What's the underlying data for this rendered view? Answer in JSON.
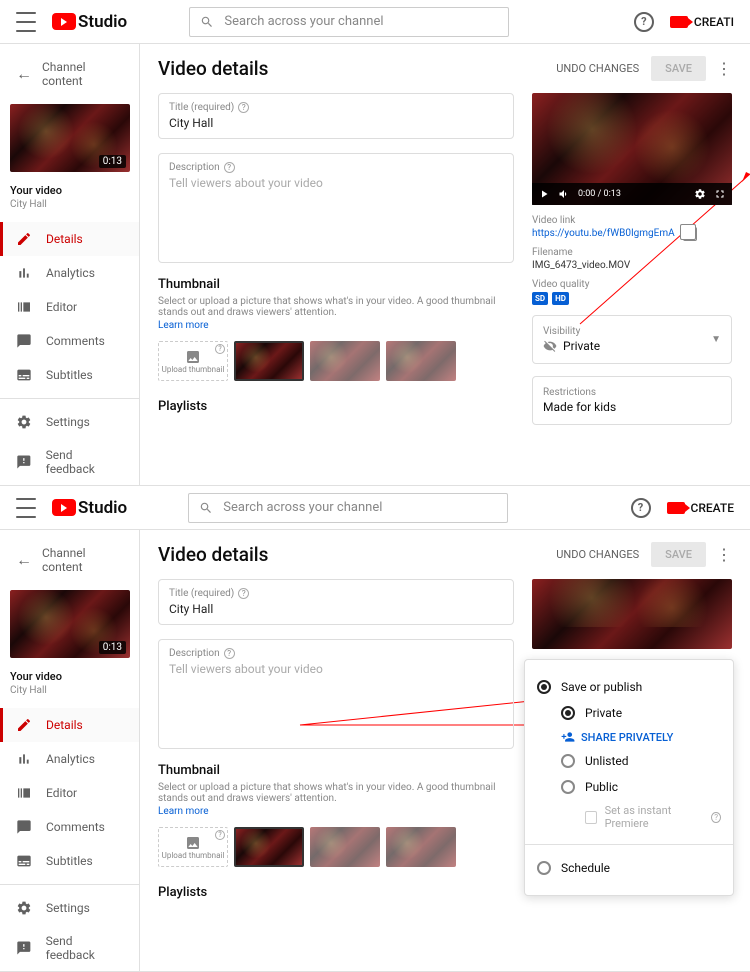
{
  "app": {
    "name": "Studio",
    "create_label": "CREATE",
    "create_label_cut": "CREATI"
  },
  "search": {
    "placeholder": "Search across your channel"
  },
  "sidebar": {
    "back_label": "Channel content",
    "video_label": "Your video",
    "video_title": "City Hall",
    "duration": "0:13",
    "nav": [
      "Details",
      "Analytics",
      "Editor",
      "Comments",
      "Subtitles"
    ],
    "footer": [
      "Settings",
      "Send feedback"
    ]
  },
  "page": {
    "title": "Video details",
    "undo": "UNDO CHANGES",
    "save": "SAVE"
  },
  "fields": {
    "title_label": "Title (required)",
    "title_value": "City Hall",
    "desc_label": "Description",
    "desc_placeholder": "Tell viewers about your video"
  },
  "thumbnail": {
    "heading": "Thumbnail",
    "desc": "Select or upload a picture that shows what's in your video. A good thumbnail stands out and draws viewers' attention.",
    "learn": "Learn more",
    "upload": "Upload thumbnail"
  },
  "playlists": {
    "heading": "Playlists"
  },
  "preview": {
    "time": "0:00 / 0:13",
    "link_label": "Video link",
    "link": "https://youtu.be/fWB0IgmgEmA",
    "filename_label": "Filename",
    "filename": "IMG_6473_video.MOV",
    "quality_label": "Video quality",
    "badges": [
      "SD",
      "HD"
    ]
  },
  "visibility": {
    "label": "Visibility",
    "value": "Private"
  },
  "restrictions": {
    "label": "Restrictions",
    "value": "Made for kids"
  },
  "popup": {
    "save_publish": "Save or publish",
    "private": "Private",
    "share": "SHARE PRIVATELY",
    "unlisted": "Unlisted",
    "public": "Public",
    "premiere": "Set as instant Premiere",
    "schedule": "Schedule"
  }
}
